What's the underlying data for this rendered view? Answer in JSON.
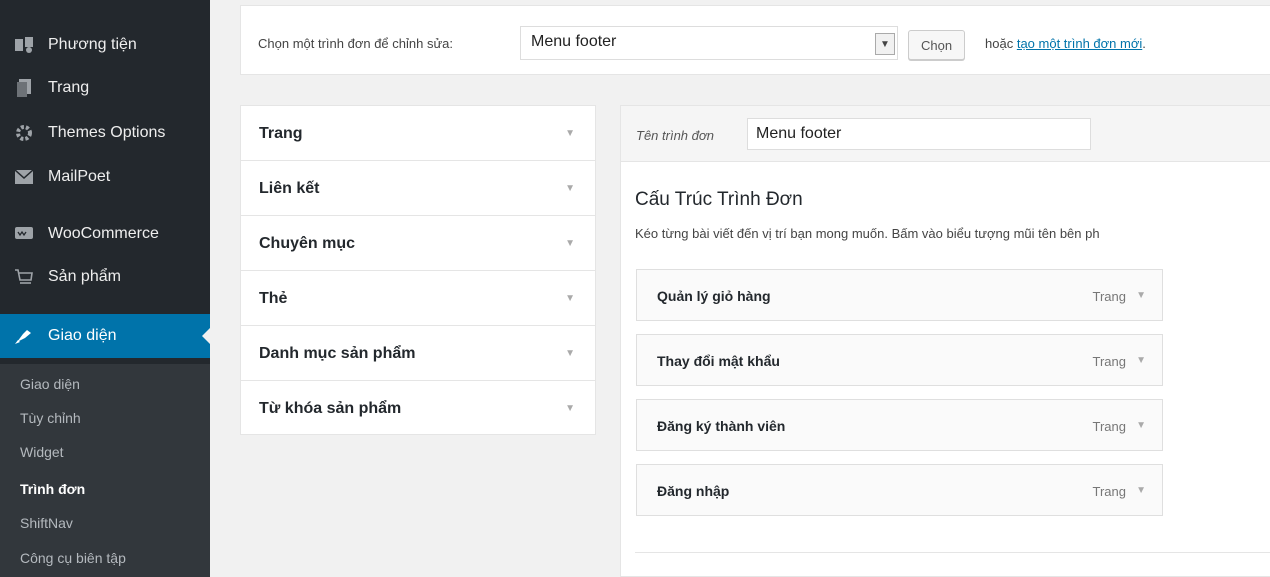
{
  "sidebar": {
    "items": [
      {
        "label": "Phương tiện",
        "icon": "media-icon"
      },
      {
        "label": "Trang",
        "icon": "page-icon"
      },
      {
        "label": "Themes Options",
        "icon": "gear-icon"
      },
      {
        "label": "MailPoet",
        "icon": "mail-icon"
      },
      {
        "label": "WooCommerce",
        "icon": "woo-icon"
      },
      {
        "label": "Sản phẩm",
        "icon": "cart-icon"
      },
      {
        "label": "Giao diện",
        "icon": "brush-icon"
      }
    ],
    "submenu": [
      "Giao diện",
      "Tùy chỉnh",
      "Widget",
      "Trình đơn",
      "ShiftNav",
      "Công cụ biên tập"
    ],
    "current_submenu": "Trình đơn"
  },
  "select_bar": {
    "label": "Chọn một trình đơn để chỉnh sửa:",
    "selected_menu": "Menu footer",
    "choose_label": "Chọn",
    "or_text": "hoặc",
    "new_menu_link": "tạo một trình đơn mới",
    "period": "."
  },
  "accordion": {
    "items": [
      "Trang",
      "Liên kết",
      "Chuyên mục",
      "Thẻ",
      "Danh mục sản phẩm",
      "Từ khóa sản phẩm"
    ]
  },
  "menu_manage": {
    "name_label": "Tên trình đơn",
    "name_value": "Menu footer",
    "structure_title": "Cấu Trúc Trình Đơn",
    "structure_desc": "Kéo từng bài viết đến vị trí bạn mong muốn. Bấm vào biểu tượng mũi tên bên ph",
    "items": [
      {
        "title": "Quản lý giỏ hàng",
        "type": "Trang"
      },
      {
        "title": "Thay đổi mật khẩu",
        "type": "Trang"
      },
      {
        "title": "Đăng ký thành viên",
        "type": "Trang"
      },
      {
        "title": "Đăng nhập",
        "type": "Trang"
      }
    ]
  },
  "colors": {
    "sidebar_bg": "#23282d",
    "active": "#0073aa",
    "link": "#0073aa"
  }
}
